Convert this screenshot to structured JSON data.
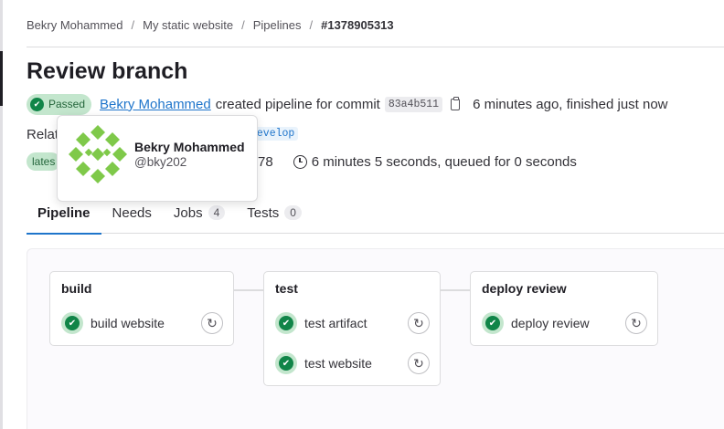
{
  "breadcrumb": {
    "items": [
      "Bekry Mohammed",
      "My static website",
      "Pipelines"
    ],
    "current": "#1378905313",
    "separator": "/"
  },
  "pipeline": {
    "title": "Review branch",
    "status": "Passed",
    "author": "Bekry Mohammed",
    "created_text": "created pipeline for commit",
    "commit_sha": "83a4b511",
    "time_text": "6 minutes ago, finished just now",
    "related_prefix": "Relat",
    "branch": "develop",
    "latest_badge": "lates",
    "jobs_fragment": "78",
    "duration_text": "6 minutes 5 seconds, queued for 0 seconds"
  },
  "tabs": [
    {
      "label": "Pipeline",
      "active": true
    },
    {
      "label": "Needs"
    },
    {
      "label": "Jobs",
      "count": "4"
    },
    {
      "label": "Tests",
      "count": "0"
    }
  ],
  "stages": [
    {
      "name": "build",
      "jobs": [
        {
          "name": "build website",
          "status": "success"
        }
      ]
    },
    {
      "name": "test",
      "jobs": [
        {
          "name": "test artifact",
          "status": "success"
        },
        {
          "name": "test website",
          "status": "success"
        }
      ]
    },
    {
      "name": "deploy review",
      "jobs": [
        {
          "name": "deploy review",
          "status": "success"
        }
      ]
    }
  ],
  "popover": {
    "name": "Bekry Mohammed",
    "username": "@bky202"
  },
  "colors": {
    "accent": "#1f75cb",
    "success": "#108548",
    "success_bg": "#c3e6cd",
    "avatar": "#7fc94a"
  },
  "icons": {
    "status": "check-circle-icon",
    "retry": "retry-icon",
    "copy": "copy-icon",
    "clock": "clock-icon"
  }
}
